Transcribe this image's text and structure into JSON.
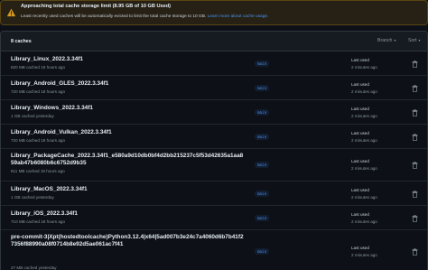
{
  "banner": {
    "title": "Approaching total cache storage limit (8.95 GB of 10 GB Used)",
    "description": "Least recently used caches will be automatically evicted to limit the total cache storage to 10 GB.",
    "link": "Learn more about cache usage."
  },
  "list": {
    "count_label": "8 caches",
    "filters": {
      "branch": "Branch",
      "sort": "Sort"
    }
  },
  "caches": [
    {
      "name": "Library_Linux_2022.3.34f1",
      "meta": "820 MB cached 19 hours ago",
      "branch": "main",
      "last_used_label": "Last used",
      "last_used": "2 minutes ago"
    },
    {
      "name": "Library_Android_GLES_2022.3.34f1",
      "meta": "720 MB cached 18 hours ago",
      "branch": "main",
      "last_used_label": "Last used",
      "last_used": "2 minutes ago"
    },
    {
      "name": "Library_Windows_2022.3.34f1",
      "meta": "1 GB cached yesterday",
      "branch": "main",
      "last_used_label": "Last used",
      "last_used": "2 minutes ago"
    },
    {
      "name": "Library_Android_Vulkan_2022.3.34f1",
      "meta": "720 MB cached 19 hours ago",
      "branch": "main",
      "last_used_label": "Last used",
      "last_used": "2 minutes ago"
    },
    {
      "name": "Library_PackageCache_2022.3.34f1_e580a9d10db0bf4d2bb215237c5f53d42635a1aa859ab47b6080b6c6752d9b35",
      "meta": "811 MB cached 19 hours ago",
      "branch": "main",
      "last_used_label": "Last used",
      "last_used": "2 minutes ago"
    },
    {
      "name": "Library_MacOS_2022.3.34f1",
      "meta": "1 GB cached yesterday",
      "branch": "main",
      "last_used_label": "Last used",
      "last_used": "2 minutes ago"
    },
    {
      "name": "Library_iOS_2022.3.34f1",
      "meta": "710 MB cached 18 hours ago",
      "branch": "main",
      "last_used_label": "Last used",
      "last_used": "2 minutes ago"
    },
    {
      "name": "pre-commit-3|Xpt(hostedtoolcache)Python3.12.4|x64|5ad007b3e24c7a4060d6b7b41f27356f88990a08f0714b8e92d5ae061ac7f41",
      "meta": "27 MB cached yesterday",
      "branch": "main",
      "last_used_label": "Last used",
      "last_used": "2 minutes ago"
    }
  ],
  "icons": {
    "warning": "warning-icon",
    "delete": "trash-icon"
  },
  "colors": {
    "warning": "#d29922",
    "link": "#4493f8",
    "background": "#0d1117"
  }
}
